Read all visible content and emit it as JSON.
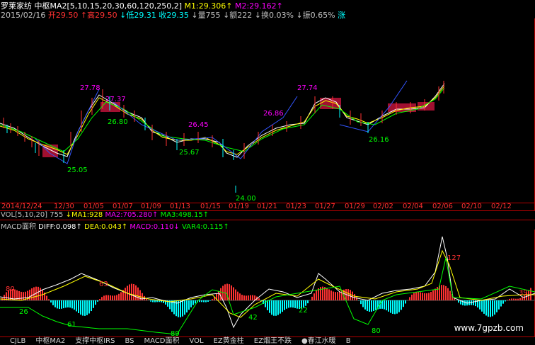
{
  "header": {
    "stock_name": "罗莱家纺",
    "indicator": "中枢MA2[5,10,15,20,30,60,120,250,2]",
    "m1": "M1:29.306",
    "m2": "M2:29.162",
    "date": "2015/02/16",
    "open": "开29.50",
    "high": "高29.50",
    "low": "低29.31",
    "close": "收29.35",
    "volume": "量755",
    "amount": "额222",
    "turnover": "换0.03%",
    "amplitude": "振0.65%",
    "rise": "涨"
  },
  "colors": {
    "up": "#ff3232",
    "down": "#00ffff",
    "green": "#00ff00",
    "magenta": "#ff00ff",
    "yellow": "#ffff00",
    "border": "#b40000",
    "label": "#c0c0c0"
  },
  "price_labels": {
    "p27_78": "27.78",
    "p27_37": "27.37",
    "p26_80": "26.80",
    "p25_05": "25.05",
    "p26_45": "26.45",
    "p25_67": "25.67",
    "p24_00": "24.00",
    "p26_86": "26.86",
    "p27_74": "27.74",
    "p26_16": "26.16"
  },
  "dates": [
    "2014/12/24",
    "12/30",
    "01/05",
    "01/07",
    "01/09",
    "01/13",
    "01/15",
    "01/19",
    "01/21",
    "01/23",
    "01/27",
    "01/29",
    "02/02",
    "02/04",
    "02/06",
    "02/10",
    "02/12"
  ],
  "vol_line": {
    "label": "VOL[5,10,20]",
    "value": "755",
    "ma1": "MA1:928",
    "ma2": "MA2:705.280",
    "ma3": "MA3:498.15"
  },
  "macd_line": {
    "label": "MACD面积",
    "diff": "DIFF:0.098",
    "dea": "DEA:0.043",
    "macd": "MACD:0.110",
    "var4": "VAR4:0.115"
  },
  "macd_labels": {
    "a80": "80",
    "a63": "63",
    "a26": "26",
    "a61": "61",
    "a89": "89",
    "a42": "42",
    "a22": "22",
    "a80b": "80",
    "a127": "127",
    "a39": "39"
  },
  "tabs": [
    "CJLB",
    "中枢MA2",
    "支撑中枢IRS",
    "BS",
    "MACD面积",
    "VOL",
    "EZ黄金柱",
    "EZ烟王不跌",
    "●春江水暖",
    "B"
  ],
  "watermark": "www.7gpzb.com"
}
